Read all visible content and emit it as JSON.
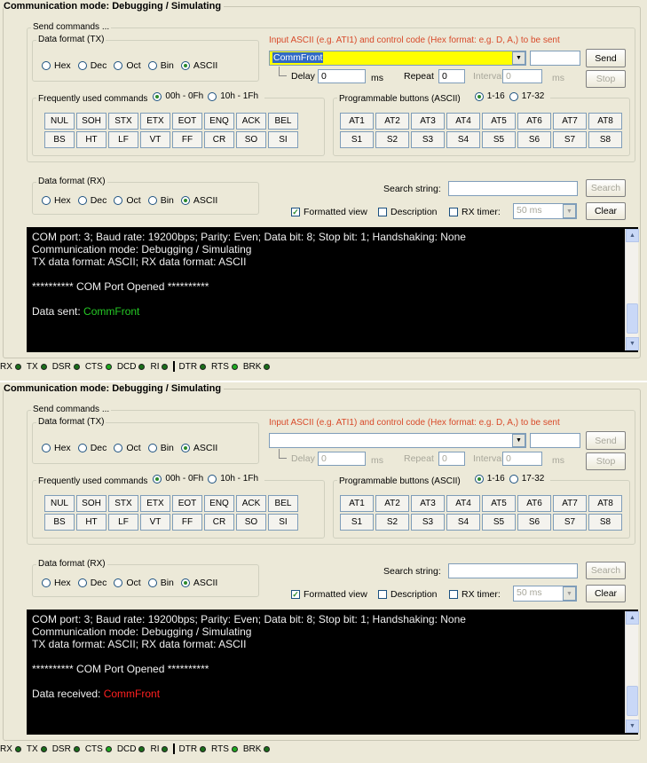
{
  "panels": [
    {
      "title": "Communication mode: Debugging / Simulating",
      "send_group": "Send commands ...",
      "tx_format": {
        "legend": "Data format (TX)",
        "options": [
          "Hex",
          "Dec",
          "Oct",
          "Bin",
          "ASCII"
        ],
        "selected": "ASCII"
      },
      "hint": "Input ASCII (e.g. ATI1) and control code (Hex format: e.g. D, A,) to be sent",
      "input_value": "CommFront",
      "input_highlighted": true,
      "hex_value": "",
      "send_label": "Send",
      "send_enabled": true,
      "stop_label": "Stop",
      "delay_label": "Delay",
      "delay_value": "0",
      "ms_label": "ms",
      "repeat_label": "Repeat",
      "repeat_value": "0",
      "interval_label": "Interval",
      "interval_value": "0",
      "interval_ms": "ms",
      "repeat_enabled": true,
      "freq": {
        "legend": "Frequently used commands",
        "options": [
          "00h - 0Fh",
          "10h - 1Fh"
        ],
        "selected": "00h - 0Fh",
        "row1": [
          "NUL",
          "SOH",
          "STX",
          "ETX",
          "EOT",
          "ENQ",
          "ACK",
          "BEL"
        ],
        "row2": [
          "BS",
          "HT",
          "LF",
          "VT",
          "FF",
          "CR",
          "SO",
          "SI"
        ]
      },
      "prog": {
        "legend": "Programmable buttons (ASCII)",
        "options": [
          "1-16",
          "17-32"
        ],
        "selected": "1-16",
        "row1": [
          "AT1",
          "AT2",
          "AT3",
          "AT4",
          "AT5",
          "AT6",
          "AT7",
          "AT8"
        ],
        "row2": [
          "S1",
          "S2",
          "S3",
          "S4",
          "S5",
          "S6",
          "S7",
          "S8"
        ]
      },
      "rx_format": {
        "legend": "Data format (RX)",
        "options": [
          "Hex",
          "Dec",
          "Oct",
          "Bin",
          "ASCII"
        ],
        "selected": "ASCII"
      },
      "search_label": "Search string:",
      "search_value": "",
      "search_button": "Search",
      "formatted_view": {
        "label": "Formatted view",
        "checked": true
      },
      "description": {
        "label": "Description",
        "checked": false
      },
      "rx_timer": {
        "label": "RX timer:",
        "checked": false,
        "value": "50 ms"
      },
      "clear_label": "Clear",
      "console": {
        "lines": [
          "COM port: 3; Baud rate: 19200bps; Parity: Even; Data bit: 8; Stop bit: 1;  Handshaking: None",
          "Communication mode: Debugging / Simulating",
          "TX data format: ASCII; RX data format: ASCII",
          "",
          "********** COM Port Opened **********",
          ""
        ],
        "data_prefix": "Data sent: ",
        "data_value": "CommFront",
        "data_color": "#25c925"
      },
      "status": [
        "RX",
        "TX",
        "DSR",
        "CTS",
        "DCD",
        "RI",
        "DTR",
        "RTS",
        "BRK"
      ]
    },
    {
      "title": "Communication mode: Debugging / Simulating",
      "send_group": "Send commands ...",
      "tx_format": {
        "legend": "Data format (TX)",
        "options": [
          "Hex",
          "Dec",
          "Oct",
          "Bin",
          "ASCII"
        ],
        "selected": "ASCII"
      },
      "hint": "Input ASCII (e.g. ATI1) and control code (Hex format: e.g. D, A,) to be sent",
      "input_value": "",
      "input_highlighted": false,
      "hex_value": "",
      "send_label": "Send",
      "send_enabled": false,
      "stop_label": "Stop",
      "delay_label": "Delay",
      "delay_value": "0",
      "ms_label": "ms",
      "repeat_label": "Repeat",
      "repeat_value": "0",
      "interval_label": "Interval",
      "interval_value": "0",
      "interval_ms": "ms",
      "repeat_enabled": false,
      "freq": {
        "legend": "Frequently used commands",
        "options": [
          "00h - 0Fh",
          "10h - 1Fh"
        ],
        "selected": "00h - 0Fh",
        "row1": [
          "NUL",
          "SOH",
          "STX",
          "ETX",
          "EOT",
          "ENQ",
          "ACK",
          "BEL"
        ],
        "row2": [
          "BS",
          "HT",
          "LF",
          "VT",
          "FF",
          "CR",
          "SO",
          "SI"
        ]
      },
      "prog": {
        "legend": "Programmable buttons (ASCII)",
        "options": [
          "1-16",
          "17-32"
        ],
        "selected": "1-16",
        "row1": [
          "AT1",
          "AT2",
          "AT3",
          "AT4",
          "AT5",
          "AT6",
          "AT7",
          "AT8"
        ],
        "row2": [
          "S1",
          "S2",
          "S3",
          "S4",
          "S5",
          "S6",
          "S7",
          "S8"
        ]
      },
      "rx_format": {
        "legend": "Data format (RX)",
        "options": [
          "Hex",
          "Dec",
          "Oct",
          "Bin",
          "ASCII"
        ],
        "selected": "ASCII"
      },
      "search_label": "Search string:",
      "search_value": "",
      "search_button": "Search",
      "formatted_view": {
        "label": "Formatted view",
        "checked": true
      },
      "description": {
        "label": "Description",
        "checked": false
      },
      "rx_timer": {
        "label": "RX timer:",
        "checked": false,
        "value": "50 ms"
      },
      "clear_label": "Clear",
      "console": {
        "lines": [
          "COM port: 3; Baud rate: 19200bps; Parity: Even; Data bit: 8; Stop bit: 1;  Handshaking: None",
          "Communication mode: Debugging / Simulating",
          "TX data format: ASCII; RX data format: ASCII",
          "",
          "********** COM Port Opened **********",
          ""
        ],
        "data_prefix": "Data received: ",
        "data_value": "CommFront",
        "data_color": "#ff2020"
      },
      "status": [
        "RX",
        "TX",
        "DSR",
        "CTS",
        "DCD",
        "RI",
        "DTR",
        "RTS",
        "BRK"
      ]
    }
  ],
  "icons": {
    "dropdown": "chevron-down-icon",
    "led": "led-indicator-icon",
    "scroll_up": "scroll-up-arrow-icon",
    "scroll_down": "scroll-down-arrow-icon"
  },
  "colors": {
    "led_on": "#1faa1f",
    "highlight": "#ffff00",
    "console_bg": "#000000",
    "dialog_bg": "#ece9d8"
  }
}
